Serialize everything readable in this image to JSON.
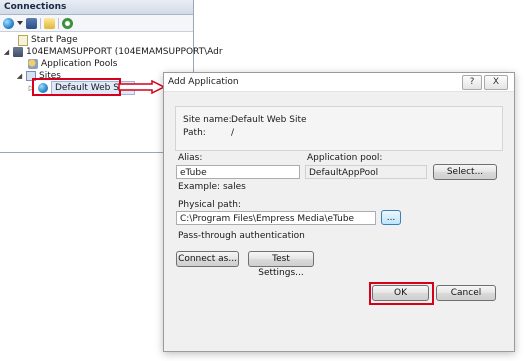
{
  "connections": {
    "title": "Connections",
    "tree": {
      "start_page": "Start Page",
      "server": "104EMAMSUPPORT (104EMAMSUPPORT\\Adr",
      "app_pools": "Application Pools",
      "sites": "Sites",
      "default_site": "Default Web Site"
    }
  },
  "dialog": {
    "title": "Add Application",
    "help_btn": "?",
    "close_btn": "X",
    "site_name_label": "Site name:",
    "site_name_value": "Default Web Site",
    "path_label": "Path:",
    "path_value": "/",
    "alias_label": "Alias:",
    "alias_value": "eTube",
    "alias_example": "Example: sales",
    "app_pool_label": "Application pool:",
    "app_pool_value": "DefaultAppPool",
    "select_button": "Select...",
    "physical_path_label": "Physical path:",
    "physical_path_value": "C:\\Program Files\\Empress Media\\eTube",
    "browse_button": "...",
    "passthrough_label": "Pass-through authentication",
    "connect_as_button": "Connect as...",
    "test_settings_button": "Test Settings...",
    "ok_button": "OK",
    "cancel_button": "Cancel"
  },
  "colors": {
    "highlight_frame": "#d6001c",
    "dialog_bg": "#f0f0f0"
  }
}
